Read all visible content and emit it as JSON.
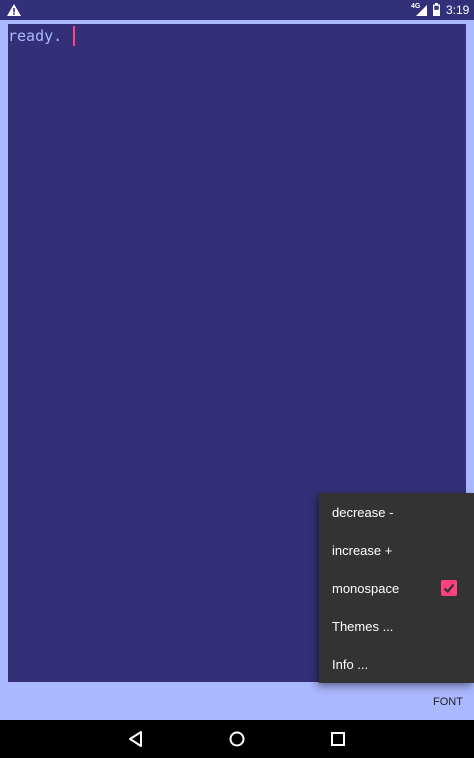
{
  "status_bar": {
    "network": "4G",
    "time": "3:19",
    "icons": [
      "warning-icon",
      "signal-icon",
      "battery-icon"
    ]
  },
  "editor": {
    "text": "ready."
  },
  "font_button": {
    "label": "FONT"
  },
  "menu": {
    "items": [
      {
        "label": "decrease -"
      },
      {
        "label": "increase +"
      },
      {
        "label": "monospace",
        "checked": true
      },
      {
        "label": "Themes ..."
      },
      {
        "label": "Info ..."
      }
    ]
  },
  "nav_bar": {
    "icons": [
      "back-icon",
      "home-icon",
      "recents-icon"
    ]
  },
  "colors": {
    "status_bar": "#313078",
    "editor_bg": "#343077",
    "app_bg": "#aab8ff",
    "text": "#aab8ff",
    "accent": "#ff4081",
    "menu_bg": "#333333"
  }
}
